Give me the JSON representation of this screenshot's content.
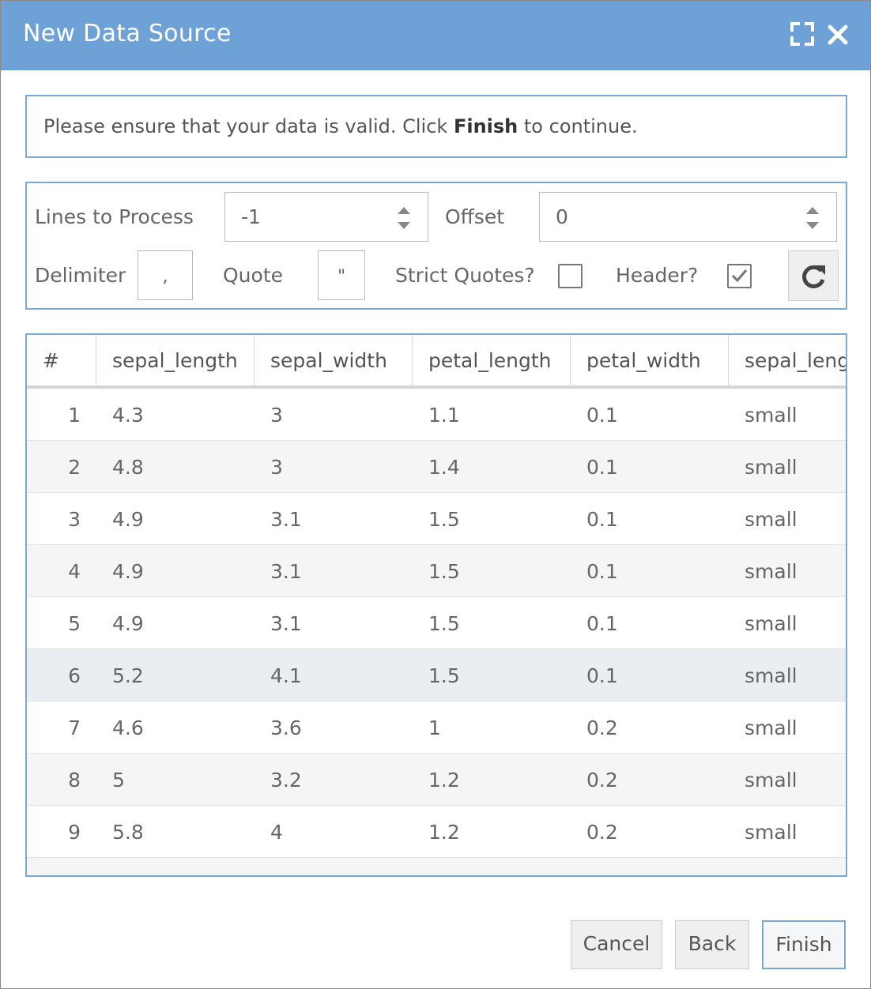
{
  "dialog": {
    "title": "New Data Source",
    "maximize_icon": "maximize-icon",
    "close_icon": "close-icon"
  },
  "info": {
    "prefix": "Please ensure that your data is valid. Click ",
    "bold": "Finish",
    "suffix": " to continue."
  },
  "settings": {
    "lines_to_process": {
      "label": "Lines to Process",
      "value": "-1"
    },
    "offset": {
      "label": "Offset",
      "value": "0"
    },
    "delimiter": {
      "label": "Delimiter",
      "value": ","
    },
    "quote": {
      "label": "Quote",
      "value": "\""
    },
    "strict_quotes": {
      "label": "Strict Quotes?",
      "checked": false
    },
    "header": {
      "label": "Header?",
      "checked": true
    },
    "refresh_icon": "refresh-icon"
  },
  "table": {
    "columns": [
      "#",
      "sepal_length",
      "sepal_width",
      "petal_length",
      "petal_width",
      "sepal_leng"
    ],
    "rows": [
      [
        "1",
        "4.3",
        "3",
        "1.1",
        "0.1",
        "small"
      ],
      [
        "2",
        "4.8",
        "3",
        "1.4",
        "0.1",
        "small"
      ],
      [
        "3",
        "4.9",
        "3.1",
        "1.5",
        "0.1",
        "small"
      ],
      [
        "4",
        "4.9",
        "3.1",
        "1.5",
        "0.1",
        "small"
      ],
      [
        "5",
        "4.9",
        "3.1",
        "1.5",
        "0.1",
        "small"
      ],
      [
        "6",
        "5.2",
        "4.1",
        "1.5",
        "0.1",
        "small"
      ],
      [
        "7",
        "4.6",
        "3.6",
        "1",
        "0.2",
        "small"
      ],
      [
        "8",
        "5",
        "3.2",
        "1.2",
        "0.2",
        "small"
      ],
      [
        "9",
        "5.8",
        "4",
        "1.2",
        "0.2",
        "small"
      ]
    ]
  },
  "footer": {
    "cancel": "Cancel",
    "back": "Back",
    "finish": "Finish"
  }
}
